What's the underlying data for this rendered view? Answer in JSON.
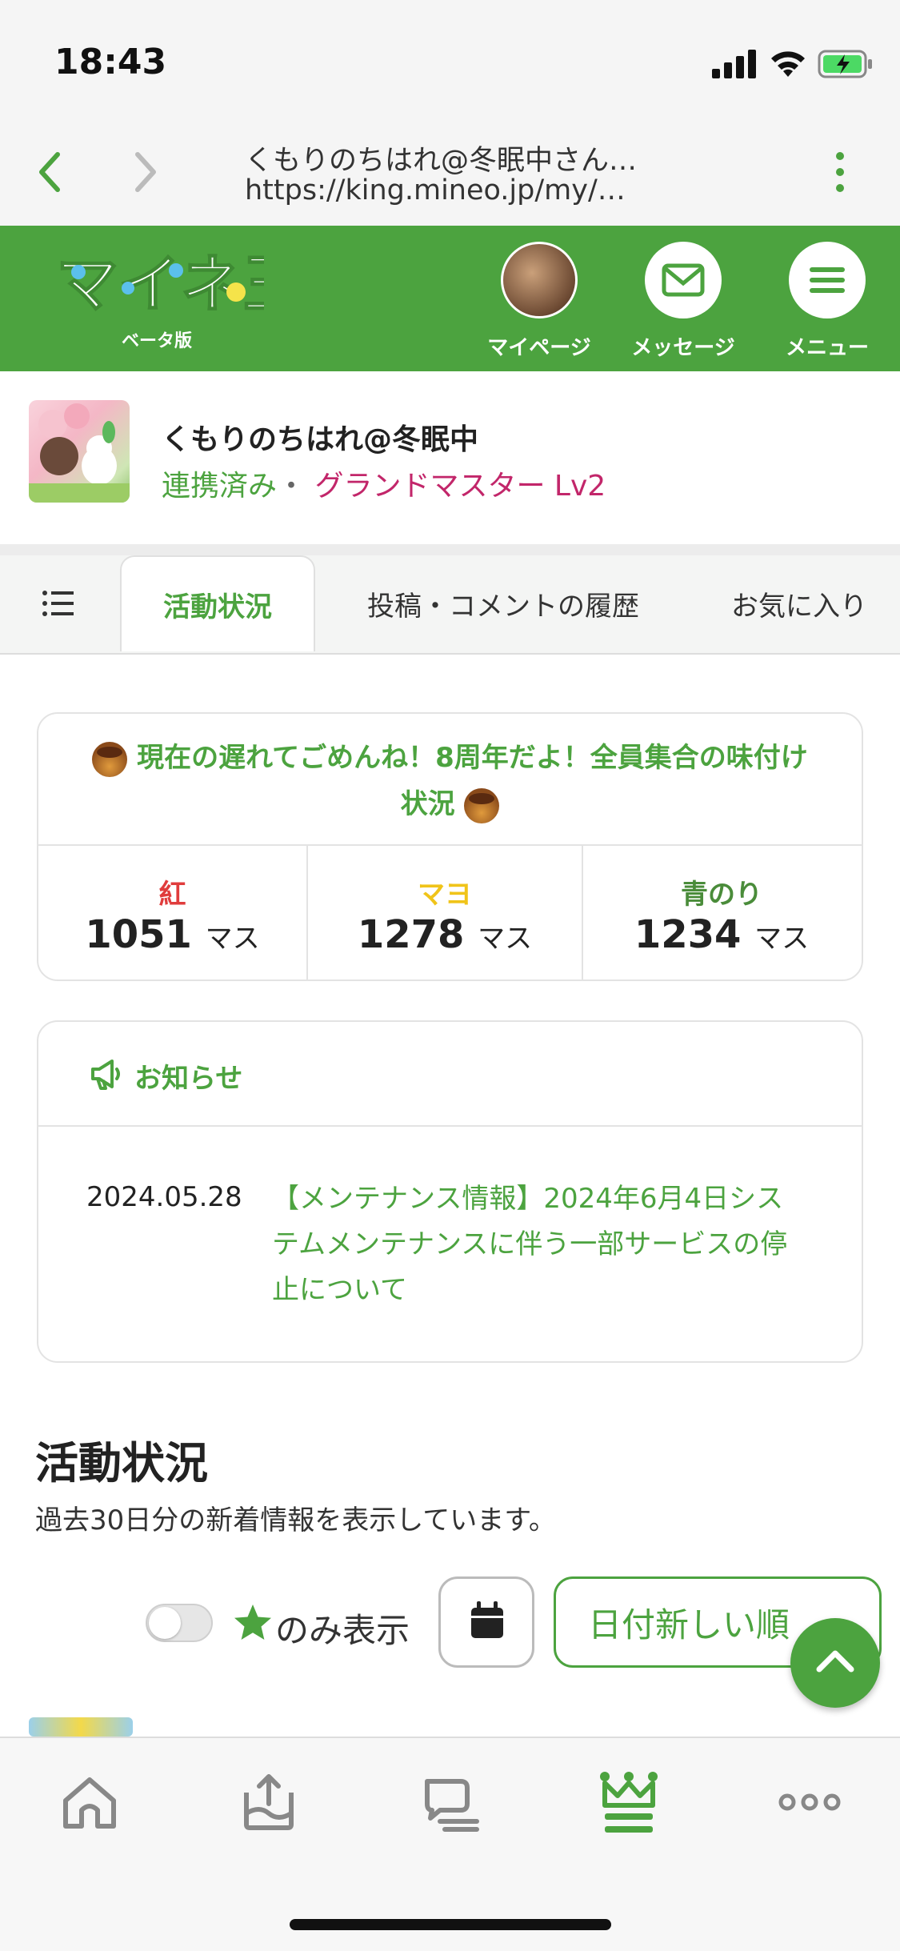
{
  "status_bar": {
    "time": "18:43"
  },
  "browser": {
    "title": "くもりのちはれ@冬眠中さん…",
    "url": "https://king.mineo.jp/my/…"
  },
  "header": {
    "logo_text": "マイネ王",
    "beta_label": "ベータ版",
    "mypage_label": "マイページ",
    "message_label": "メッセージ",
    "menu_label": "メニュー",
    "accent_color": "#4ca33f"
  },
  "profile": {
    "name": "くもりのちはれ@冬眠中",
    "linked": "連携済み",
    "separator": "・",
    "rank": "グランドマスター Lv2"
  },
  "tabs": [
    {
      "label": "活動状況",
      "active": true
    },
    {
      "label": "投稿・コメントの履歴",
      "active": false
    },
    {
      "label": "お気に入り",
      "active": false
    }
  ],
  "campaign": {
    "title_line1": "現在の遅れてごめんね！8周年だよ！全員集合の味付け",
    "title_line2": "状況",
    "scores": [
      {
        "label": "紅",
        "value": "1051",
        "unit": "マス",
        "color": "#e03c3c"
      },
      {
        "label": "マヨ",
        "value": "1278",
        "unit": "マス",
        "color": "#f0c419"
      },
      {
        "label": "青のり",
        "value": "1234",
        "unit": "マス",
        "color": "#4a8c3a"
      }
    ]
  },
  "notice": {
    "title": "お知らせ",
    "date": "2024.05.28",
    "text": "【メンテナンス情報】2024年6月4日システムメンテナンスに伴う一部サービスの停止について"
  },
  "activity": {
    "title": "活動状況",
    "subtitle": "過去30日分の新着情報を表示しています。",
    "only_label": "のみ表示",
    "sort_label": "日付新しい順"
  },
  "bottom_nav": [
    "home-icon",
    "upload-icon",
    "chat-icon",
    "crown-icon",
    "more-icon"
  ]
}
